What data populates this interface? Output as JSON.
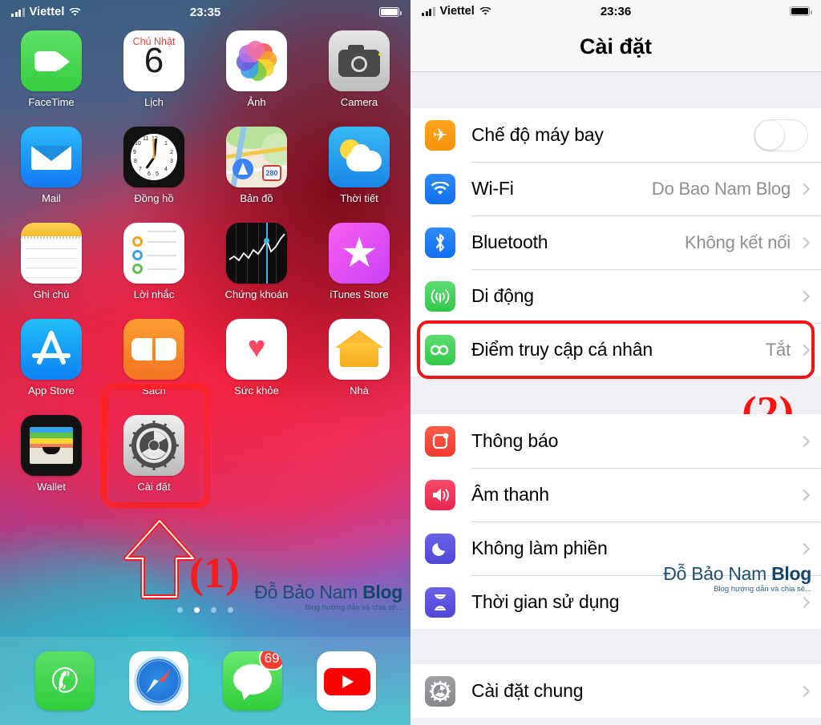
{
  "left_phone": {
    "status_bar": {
      "carrier": "Viettel",
      "time": "23:35",
      "wifi_icon": "wifi-icon",
      "signal_icon": "signal-bars-icon",
      "battery_icon": "battery-icon"
    },
    "home_screen": {
      "apps": [
        {
          "label": "FaceTime",
          "icon": "facetime-icon"
        },
        {
          "label": "Lịch",
          "icon": "calendar-icon",
          "weekday": "Chủ Nhật",
          "day": "6"
        },
        {
          "label": "Ảnh",
          "icon": "photos-icon"
        },
        {
          "label": "Camera",
          "icon": "camera-icon"
        },
        {
          "label": "Mail",
          "icon": "mail-icon"
        },
        {
          "label": "Đồng hồ",
          "icon": "clock-icon"
        },
        {
          "label": "Bản đồ",
          "icon": "maps-icon",
          "road_shield": "280"
        },
        {
          "label": "Thời tiết",
          "icon": "weather-icon"
        },
        {
          "label": "Ghi chú",
          "icon": "notes-icon"
        },
        {
          "label": "Lời nhắc",
          "icon": "reminders-icon"
        },
        {
          "label": "Chứng khoán",
          "icon": "stocks-icon"
        },
        {
          "label": "iTunes Store",
          "icon": "itunes-store-icon"
        },
        {
          "label": "App Store",
          "icon": "app-store-icon"
        },
        {
          "label": "Sách",
          "icon": "books-icon"
        },
        {
          "label": "Sức khỏe",
          "icon": "health-icon"
        },
        {
          "label": "Nhà",
          "icon": "home-icon"
        },
        {
          "label": "Wallet",
          "icon": "wallet-icon"
        },
        {
          "label": "Cài đặt",
          "icon": "settings-icon"
        }
      ],
      "page_dots": {
        "count": 4,
        "active_index": 1
      },
      "dock": [
        {
          "label": "Phone",
          "icon": "phone-icon"
        },
        {
          "label": "Safari",
          "icon": "safari-icon"
        },
        {
          "label": "Messages",
          "icon": "messages-icon",
          "badge": "69"
        },
        {
          "label": "YouTube",
          "icon": "youtube-icon"
        }
      ]
    },
    "annotations": {
      "step_label": "(1)",
      "highlight_target": "Cài đặt",
      "arrow_icon": "up-arrow-icon",
      "highlight_color": "#ff2020"
    },
    "watermark": {
      "title_normal": "Đỗ Bảo Nam ",
      "title_bold": "Blog",
      "tagline": "Blog hướng dẫn và chia sẻ..."
    }
  },
  "right_phone": {
    "status_bar": {
      "carrier": "Viettel",
      "time": "23:36",
      "wifi_icon": "wifi-icon",
      "signal_icon": "signal-bars-icon",
      "battery_icon": "battery-icon"
    },
    "nav_title": "Cài đặt",
    "sections": [
      {
        "rows": [
          {
            "label": "Chế độ máy bay",
            "icon": "airplane-mode-icon",
            "control": "toggle",
            "toggle_on": false
          },
          {
            "label": "Wi-Fi",
            "icon": "wifi-settings-icon",
            "value": "Do Bao Nam Blog",
            "control": "chevron"
          },
          {
            "label": "Bluetooth",
            "icon": "bluetooth-icon",
            "value": "Không kết nối",
            "control": "chevron"
          },
          {
            "label": "Di động",
            "icon": "cellular-icon",
            "value": "",
            "control": "chevron"
          },
          {
            "label": "Điểm truy cập cá nhân",
            "icon": "personal-hotspot-icon",
            "value": "Tắt",
            "control": "chevron",
            "highlighted": true
          }
        ]
      },
      {
        "rows": [
          {
            "label": "Thông báo",
            "icon": "notifications-icon",
            "value": "",
            "control": "chevron"
          },
          {
            "label": "Âm thanh",
            "icon": "sounds-icon",
            "value": "",
            "control": "chevron"
          },
          {
            "label": "Không làm phiền",
            "icon": "do-not-disturb-icon",
            "value": "",
            "control": "chevron"
          },
          {
            "label": "Thời gian sử dụng",
            "icon": "screen-time-icon",
            "value": "",
            "control": "chevron"
          }
        ]
      },
      {
        "rows": [
          {
            "label": "Cài đặt chung",
            "icon": "general-settings-icon",
            "value": "",
            "control": "chevron"
          }
        ]
      }
    ],
    "annotations": {
      "step_label": "(2)",
      "highlight_target": "Điểm truy cập cá nhân",
      "highlight_color": "#f01414"
    },
    "watermark": {
      "title_normal": "Đỗ Bảo Nam ",
      "title_bold": "Blog",
      "tagline": "Blog hướng dẫn và chia sẻ..."
    }
  }
}
